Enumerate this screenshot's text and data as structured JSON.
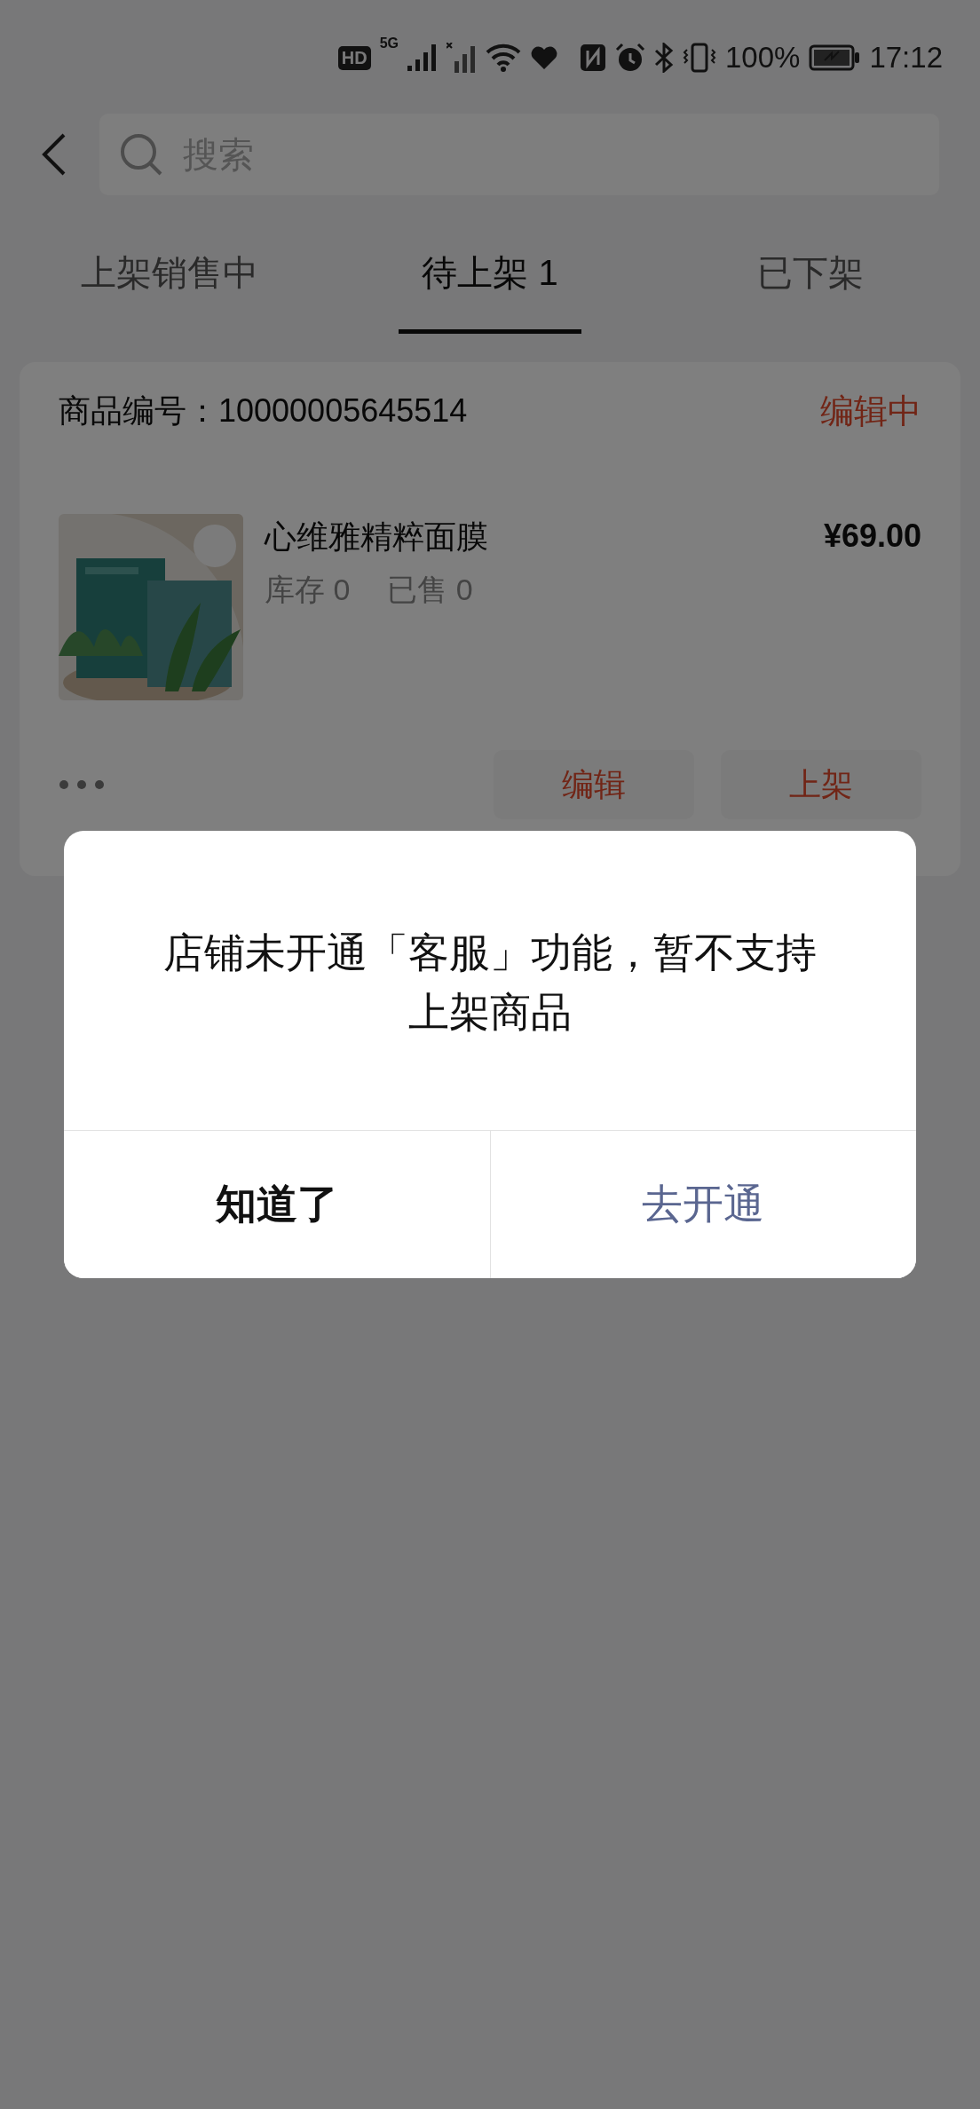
{
  "status_bar": {
    "badges": [
      "HD",
      "5G"
    ],
    "battery": "100%",
    "time": "17:12"
  },
  "search": {
    "placeholder": "搜索"
  },
  "tabs": [
    {
      "label": "上架销售中",
      "selected": false
    },
    {
      "label": "待上架 1",
      "selected": true
    },
    {
      "label": "已下架",
      "selected": false
    }
  ],
  "products": [
    {
      "number_label": "商品编号：",
      "number": "10000005645514",
      "status": "编辑中",
      "name": "心维雅精粹面膜",
      "stock": "库存 0",
      "sold": "已售 0",
      "price": "¥69.00",
      "actions": [
        "编辑",
        "上架"
      ]
    }
  ],
  "dialog": {
    "message": "店铺未开通「客服」功能，暂不支持上架商品",
    "buttons": [
      {
        "label": "知道了",
        "kind": "secondary"
      },
      {
        "label": "去开通",
        "kind": "primary"
      }
    ]
  }
}
